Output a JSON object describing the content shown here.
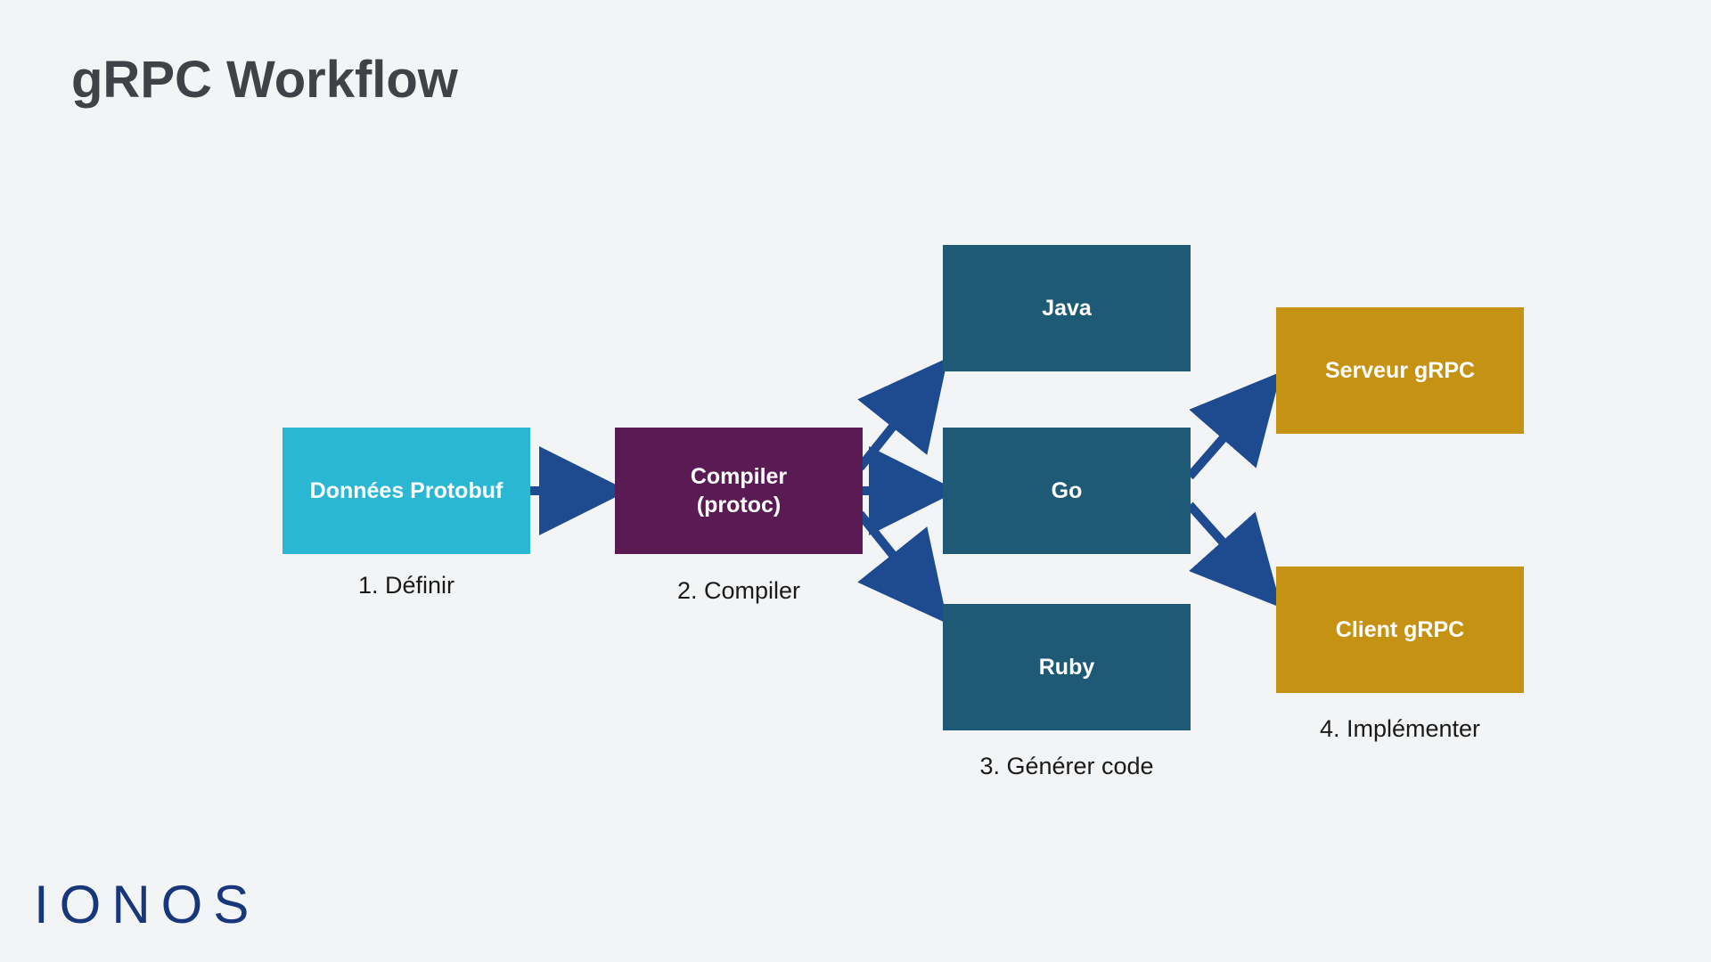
{
  "title": "gRPC Workflow",
  "logo": "IONOS",
  "colors": {
    "cyan": "#29b7d3",
    "purple": "#5a1a54",
    "teal": "#1e5a75",
    "gold": "#c69214",
    "arrow": "#1e4b8f"
  },
  "boxes": {
    "protobuf": "Données Protobuf",
    "compiler_l1": "Compiler",
    "compiler_l2": "(protoc)",
    "java": "Java",
    "go": "Go",
    "ruby": "Ruby",
    "server": "Serveur gRPC",
    "client": "Client gRPC"
  },
  "captions": {
    "step1": "1. Définir",
    "step2": "2. Compiler",
    "step3": "3. Générer code",
    "step4": "4. Implémenter"
  }
}
